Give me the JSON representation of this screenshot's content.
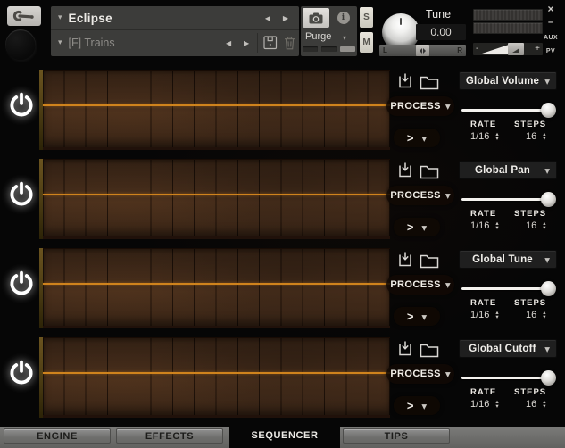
{
  "header": {
    "instrument_title": "Eclipse",
    "patch_name": "[F] Trains",
    "purge_label": "Purge",
    "solo_label": "S",
    "mute_label": "M",
    "tune_label": "Tune",
    "tune_value": "0.00",
    "pan_left_label": "L",
    "pan_right_label": "R",
    "volume_minus_label": "-",
    "volume_plus_label": "+"
  },
  "window_controls": {
    "close": "×",
    "minimize": "–",
    "aux_label": "AUX",
    "pv_label": "PV"
  },
  "icons": {
    "caret_down": "▾",
    "caret_down_bold": "▼",
    "prev_arrow": "◀",
    "next_arrow": "▶",
    "stepper_up": "▴",
    "stepper_down": "▾",
    "info": "i"
  },
  "sequencer": {
    "row_labels": {
      "process": "PROCESS",
      "rate": "RATE",
      "steps": "STEPS",
      "arrow": ">"
    },
    "rows": [
      {
        "target": "Global Volume",
        "rate_value": "1/16",
        "steps_value": "16",
        "step_count": 16,
        "power": "on",
        "slider_position": 1.0,
        "flat_value_line": true
      },
      {
        "target": "Global Pan",
        "rate_value": "1/16",
        "steps_value": "16",
        "step_count": 16,
        "power": "on",
        "slider_position": 1.0,
        "flat_value_line": true
      },
      {
        "target": "Global Tune",
        "rate_value": "1/16",
        "steps_value": "16",
        "step_count": 16,
        "power": "on",
        "slider_position": 1.0,
        "flat_value_line": true
      },
      {
        "target": "Global Cutoff",
        "rate_value": "1/16",
        "steps_value": "16",
        "step_count": 16,
        "power": "on",
        "slider_position": 1.0,
        "flat_value_line": true
      }
    ]
  },
  "tabs": [
    {
      "label": "ENGINE",
      "active": false
    },
    {
      "label": "EFFECTS",
      "active": false
    },
    {
      "label": "SEQUENCER",
      "active": true
    },
    {
      "label": "TIPS",
      "active": false
    }
  ],
  "colors": {
    "accent_orange": "#cf831d",
    "grid_brown": "#472e1c",
    "panel_grey": "#3c3c3a",
    "tab_grey": "#6e6e6c",
    "background": "#060606"
  }
}
